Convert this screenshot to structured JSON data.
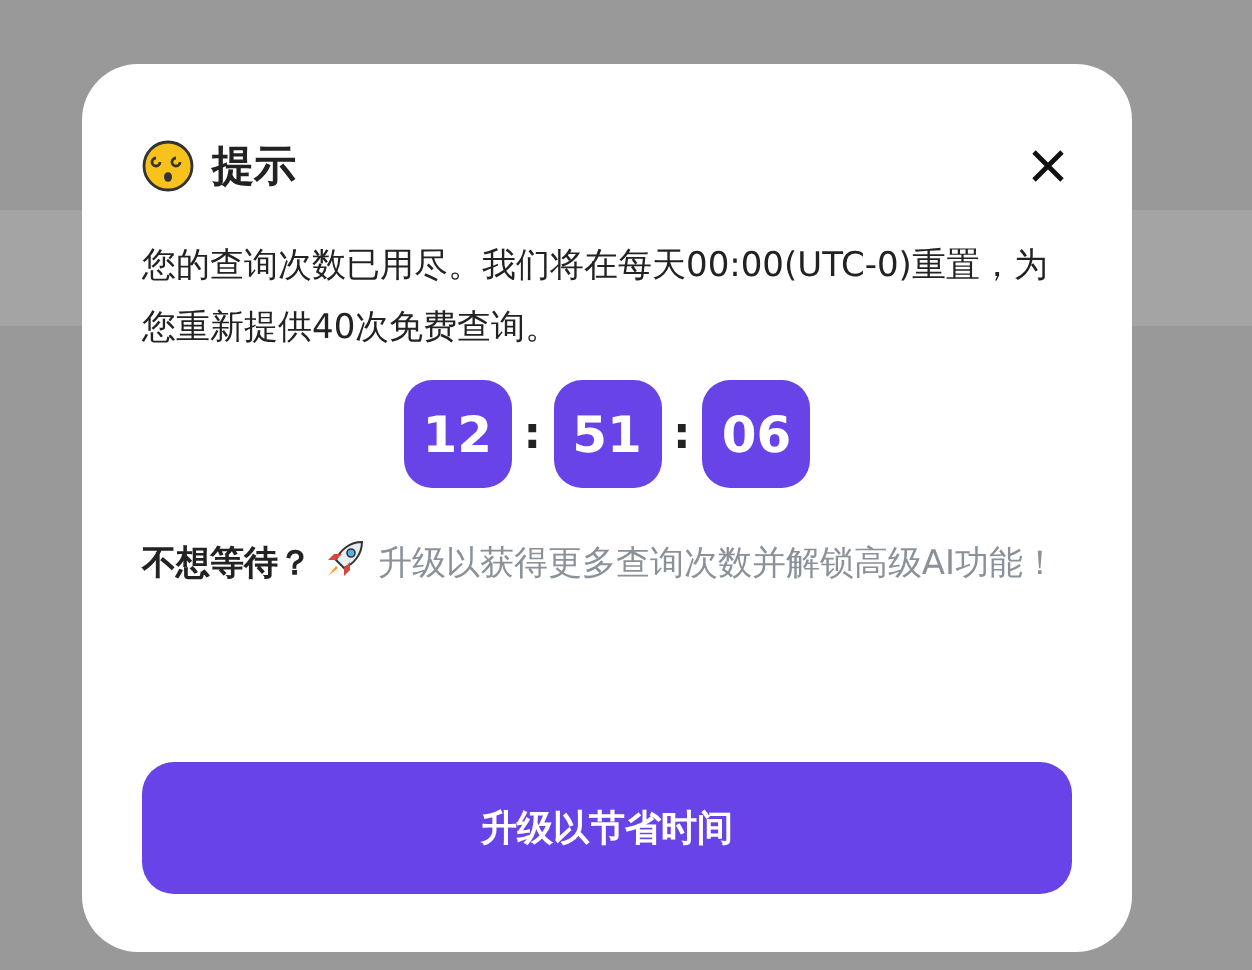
{
  "dialog": {
    "title": "提示",
    "message": "您的查询次数已用尽。我们将在每天00:00(UTC-0)重置，为您重新提供40次免费查询。",
    "countdown": [
      "12",
      "51",
      "06"
    ],
    "separator": ":",
    "prompt": "不想等待？",
    "upsell": "升级以获得更多查询次数并解锁高级AI功能！",
    "button": "升级以节省时间"
  }
}
